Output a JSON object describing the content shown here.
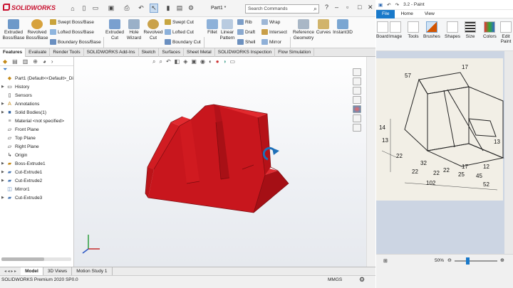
{
  "sw": {
    "brand": "SOLIDWORKS",
    "doc_title": "Part1 *",
    "search_placeholder": "Search Commands",
    "ribbon": {
      "extruded_boss": "Extruded\nBoss/Base",
      "revolved_boss": "Revolved\nBoss/Base",
      "swept_boss": "Swept Boss/Base",
      "lofted_boss": "Lofted Boss/Base",
      "boundary_boss": "Boundary Boss/Base",
      "extruded_cut": "Extruded\nCut",
      "hole_wizard": "Hole\nWizard",
      "revolved_cut": "Revolved\nCut",
      "swept_cut": "Swept Cut",
      "lofted_cut": "Lofted Cut",
      "boundary_cut": "Boundary Cut",
      "fillet": "Fillet",
      "linear_pattern": "Linear\nPattern",
      "rib": "Rib",
      "draft": "Draft",
      "shell": "Shell",
      "wrap": "Wrap",
      "intersect": "Intersect",
      "mirror": "Mirror",
      "reference_geometry": "Reference\nGeometry",
      "curves": "Curves",
      "instant3d": "Instant3D"
    },
    "tabs": [
      "Features",
      "Evaluate",
      "Render Tools",
      "SOLIDWORKS Add-Ins",
      "Sketch",
      "Surfaces",
      "Sheet Metal",
      "SOLIDWORKS Inspection",
      "Flow Simulation"
    ],
    "tree": [
      {
        "label": "Part1  (Default<<Default>_Di",
        "icon": "part-icon",
        "arrow": ""
      },
      {
        "label": "History",
        "icon": "history-icon",
        "arrow": "▶"
      },
      {
        "label": "Sensors",
        "icon": "sensor-icon",
        "arrow": ""
      },
      {
        "label": "Annotations",
        "icon": "annotation-icon",
        "arrow": "▶"
      },
      {
        "label": "Solid Bodies(1)",
        "icon": "solid-bodies-icon",
        "arrow": "▶"
      },
      {
        "label": "Material <not specified>",
        "icon": "material-icon",
        "arrow": ""
      },
      {
        "label": "Front Plane",
        "icon": "plane-icon",
        "arrow": ""
      },
      {
        "label": "Top Plane",
        "icon": "plane-icon",
        "arrow": ""
      },
      {
        "label": "Right Plane",
        "icon": "plane-icon",
        "arrow": ""
      },
      {
        "label": "Origin",
        "icon": "origin-icon",
        "arrow": ""
      },
      {
        "label": "Boss-Extrude1",
        "icon": "extrude-icon",
        "arrow": "▶"
      },
      {
        "label": "Cut-Extrude1",
        "icon": "cut-icon",
        "arrow": "▶"
      },
      {
        "label": "Cut-Extrude2",
        "icon": "cut-icon",
        "arrow": "▶"
      },
      {
        "label": "Mirror1",
        "icon": "mirror-icon",
        "arrow": ""
      },
      {
        "label": "Cut-Extrude3",
        "icon": "cut-icon",
        "arrow": "▶"
      }
    ],
    "bottom_tabs": [
      "Model",
      "3D Views",
      "Motion Study 1"
    ],
    "status_left": "SOLIDWORKS Premium 2020 SP0.0",
    "units": "MMGS",
    "colors": {
      "part_red": "#c8161d",
      "accent": "#c8102e"
    }
  },
  "paint": {
    "title": "3.2 - Paint",
    "menu": [
      "File",
      "Home",
      "View"
    ],
    "ribbon": [
      "Board",
      "Image",
      "Tools",
      "Brushes",
      "Shapes",
      "Size",
      "Colors",
      "Edit Paint"
    ],
    "zoom": "50%",
    "drawing_dims": [
      "57",
      "17",
      "22",
      "32",
      "14",
      "22",
      "45",
      "32",
      "13",
      "22",
      "22",
      "25",
      "102",
      "12",
      "13",
      "17",
      "52"
    ]
  }
}
